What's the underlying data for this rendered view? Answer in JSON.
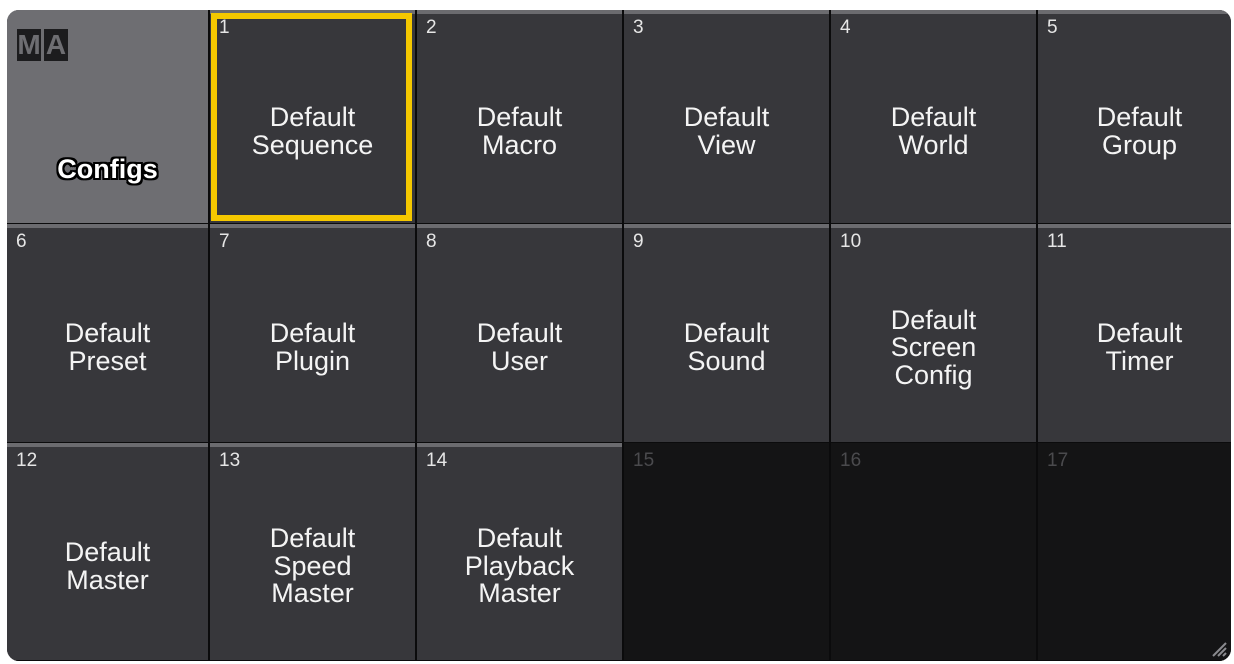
{
  "window": {
    "title": "Configs",
    "logo_letters": [
      "M",
      "A"
    ]
  },
  "cells": [
    {
      "num": "1",
      "label": "Default\nSequence",
      "selected": true
    },
    {
      "num": "2",
      "label": "Default\nMacro"
    },
    {
      "num": "3",
      "label": "Default\nView"
    },
    {
      "num": "4",
      "label": "Default\nWorld"
    },
    {
      "num": "5",
      "label": "Default\nGroup"
    },
    {
      "num": "6",
      "label": "Default\nPreset"
    },
    {
      "num": "7",
      "label": "Default\nPlugin"
    },
    {
      "num": "8",
      "label": "Default\nUser"
    },
    {
      "num": "9",
      "label": "Default\nSound"
    },
    {
      "num": "10",
      "label": "Default\nScreen\nConfig"
    },
    {
      "num": "11",
      "label": "Default\nTimer"
    },
    {
      "num": "12",
      "label": "Default\nMaster"
    },
    {
      "num": "13",
      "label": "Default\nSpeed\nMaster"
    },
    {
      "num": "14",
      "label": "Default\nPlayback\nMaster"
    },
    {
      "num": "15",
      "label": ""
    },
    {
      "num": "16",
      "label": ""
    },
    {
      "num": "17",
      "label": ""
    }
  ],
  "colors": {
    "selection": "#f5c800",
    "cell_bg": "#37373b",
    "empty_bg": "#141415",
    "title_bg": "#6e6e72"
  },
  "icons": {
    "resize": "resize-grip-icon"
  }
}
